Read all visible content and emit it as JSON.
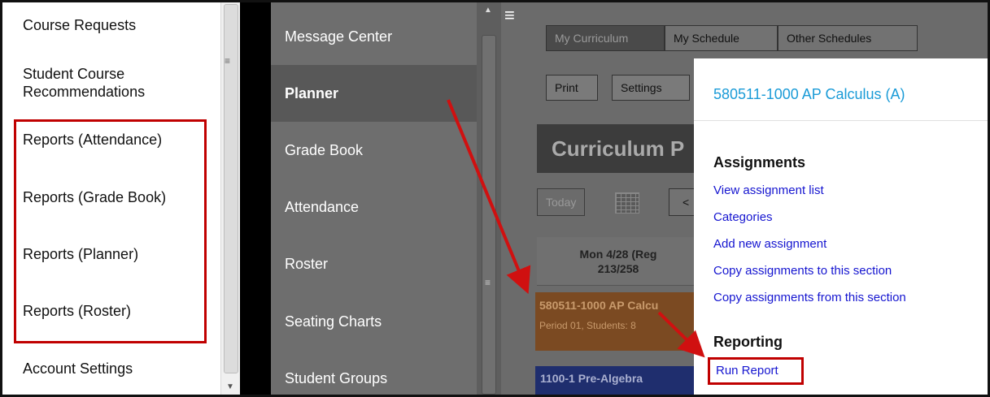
{
  "left_menu": {
    "items": [
      {
        "label": "Course Requests"
      },
      {
        "label": "Student Course\nRecommendations"
      },
      {
        "label": "Reports (Attendance)"
      },
      {
        "label": "Reports (Grade Book)"
      },
      {
        "label": "Reports (Planner)"
      },
      {
        "label": "Reports (Roster)"
      },
      {
        "label": "Account Settings"
      }
    ]
  },
  "nav_menu": {
    "items": [
      {
        "label": "Message Center"
      },
      {
        "label": "Planner",
        "active": true
      },
      {
        "label": "Grade Book"
      },
      {
        "label": "Attendance"
      },
      {
        "label": "Roster"
      },
      {
        "label": "Seating Charts"
      },
      {
        "label": "Student Groups"
      }
    ]
  },
  "tabs": [
    {
      "label": "My Curriculum",
      "selected": true
    },
    {
      "label": "My Schedule"
    },
    {
      "label": "Other Schedules"
    }
  ],
  "toolbar": {
    "print_label": "Print",
    "settings_label": "Settings"
  },
  "curriculum": {
    "title": "Curriculum P",
    "today_label": "Today",
    "prev_label": "<",
    "day_label": "Mon 4/28 (Reg",
    "day_count": "213/258",
    "course_1": "580511-1000 AP Calcu",
    "course_1_detail": "Period 01, Students: 8",
    "course_2": "1100-1 Pre-Algebra"
  },
  "popup": {
    "title": "580511-1000 AP Calculus (A)",
    "assignments_heading": "Assignments",
    "links": [
      "View assignment list",
      "Categories",
      "Add new assignment",
      "Copy assignments to this section",
      "Copy assignments from this section"
    ],
    "reporting_heading": "Reporting",
    "run_report_label": "Run Report"
  },
  "icons": {
    "menu": "hamburger-menu-icon",
    "calendar": "calendar-icon",
    "grip": "scroll-grip-icon"
  },
  "colors": {
    "accent_red": "#c00000",
    "popup_title": "#1a9bd7",
    "link": "#1515d0",
    "course_orange": "#c8681f",
    "course_blue": "#2040c0"
  }
}
